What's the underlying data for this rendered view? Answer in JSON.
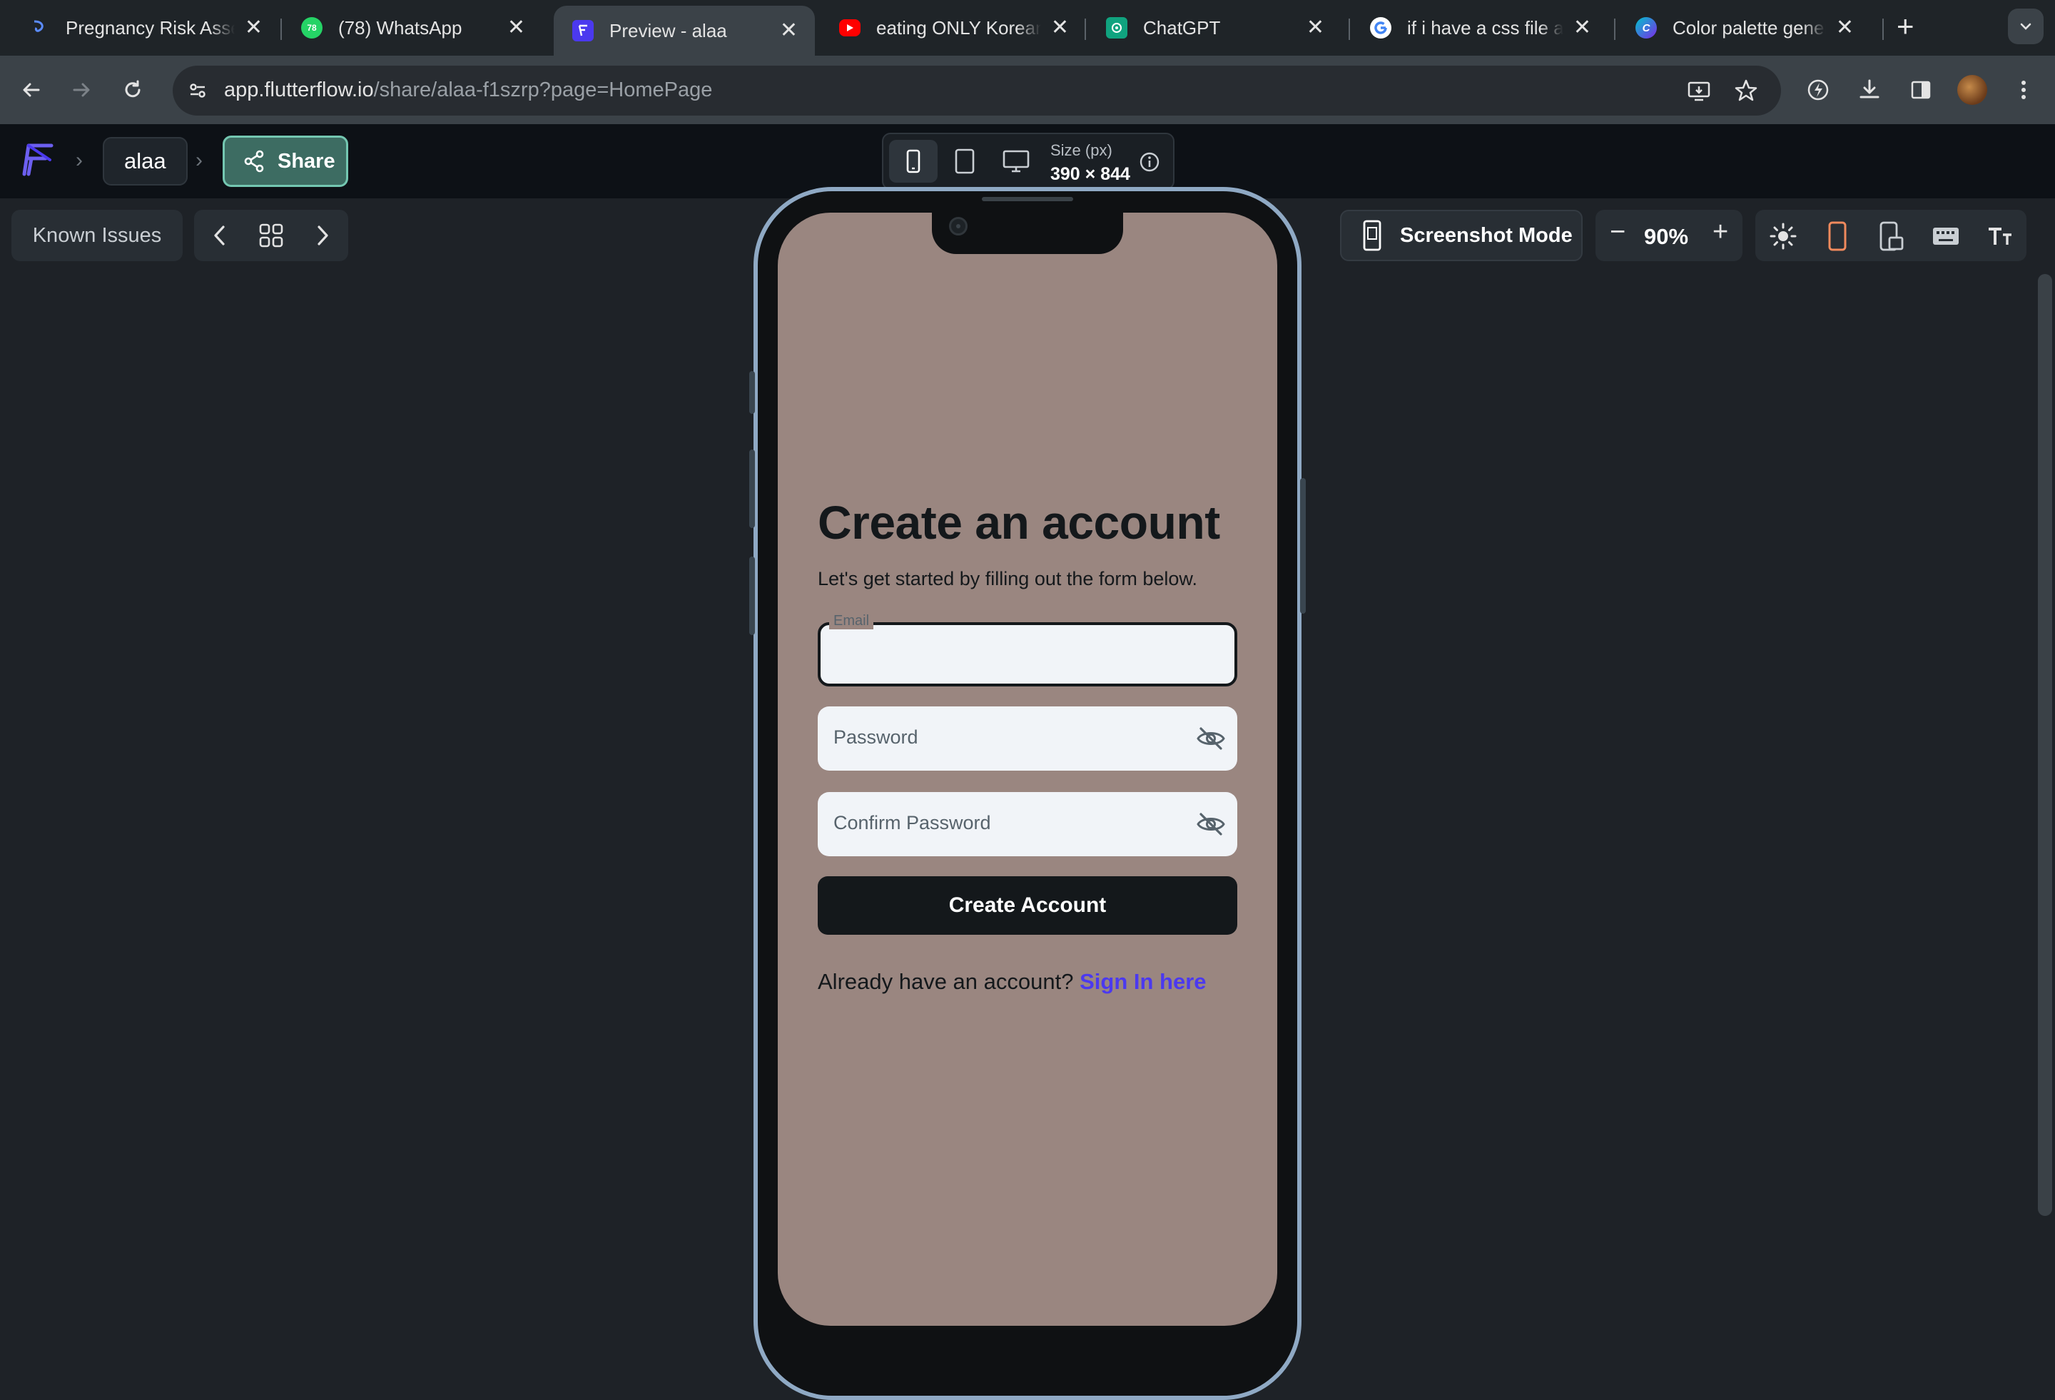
{
  "browser": {
    "tabs": [
      {
        "title": "Pregnancy Risk Assessment",
        "icon": "deepseek-icon",
        "active": false
      },
      {
        "title": "(78) WhatsApp",
        "icon": "whatsapp-icon",
        "badge": "78",
        "active": false
      },
      {
        "title": "Preview - alaa",
        "icon": "flutterflow-icon",
        "active": true
      },
      {
        "title": "eating ONLY Korean",
        "icon": "youtube-icon",
        "active": false
      },
      {
        "title": "ChatGPT",
        "icon": "chatgpt-icon",
        "active": false
      },
      {
        "title": "if i have a css file and",
        "icon": "google-icon",
        "active": false
      },
      {
        "title": "Color palette generator",
        "icon": "canva-icon",
        "active": false
      }
    ],
    "close_glyph": "✕",
    "new_tab_glyph": "+",
    "url_host": "app.flutterflow.io",
    "url_path": "/share/alaa-f1szrp?page=HomePage"
  },
  "header": {
    "project_name": "alaa",
    "share_label": "Share",
    "size_label": "Size (px)",
    "size_value": "390 × 844"
  },
  "canvas": {
    "known_issues_label": "Known Issues",
    "screenshot_mode_label": "Screenshot Mode",
    "zoom_value": "90%",
    "zoom_minus": "−",
    "zoom_plus": "+"
  },
  "app": {
    "background_color": "#9a8680",
    "title": "Create an account",
    "subtitle": "Let's get started by filling out the form below.",
    "email_label": "Email",
    "email_value": "",
    "password_placeholder": "Password",
    "confirm_password_placeholder": "Confirm Password",
    "create_button_label": "Create Account",
    "signin_prompt": "Already have an account? ",
    "signin_link": "Sign In here"
  },
  "colors": {
    "accent_link": "#4b39ef",
    "share_button": "#3d6c62",
    "dark_text": "#14181b"
  }
}
